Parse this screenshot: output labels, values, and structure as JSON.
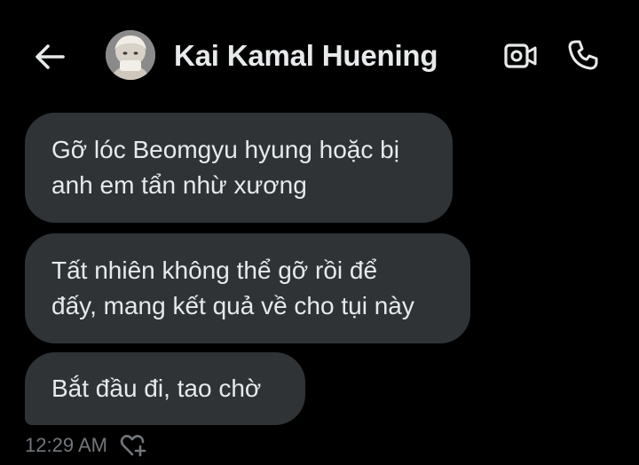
{
  "header": {
    "back_icon": "arrow-left-icon",
    "contact_name": "Kai Kamal Huening",
    "video_icon": "video-camera-icon",
    "call_icon": "phone-icon"
  },
  "messages": [
    {
      "lines": [
        "Gỡ lóc Beomgyu hyung hoặc bị",
        "anh em tẩn nhừ xương"
      ]
    },
    {
      "lines": [
        "Tất nhiên không thể gỡ rồi để",
        "đấy, mang kết quả về cho tụi này"
      ]
    },
    {
      "lines": [
        "Bắt đầu đi, tao chờ"
      ]
    }
  ],
  "footer": {
    "timestamp": "12:29 AM",
    "react_icon": "heart-plus-icon"
  },
  "colors": {
    "background": "#000000",
    "bubble": "#2f3336",
    "text": "#e7e9ea",
    "muted": "#71767b"
  }
}
